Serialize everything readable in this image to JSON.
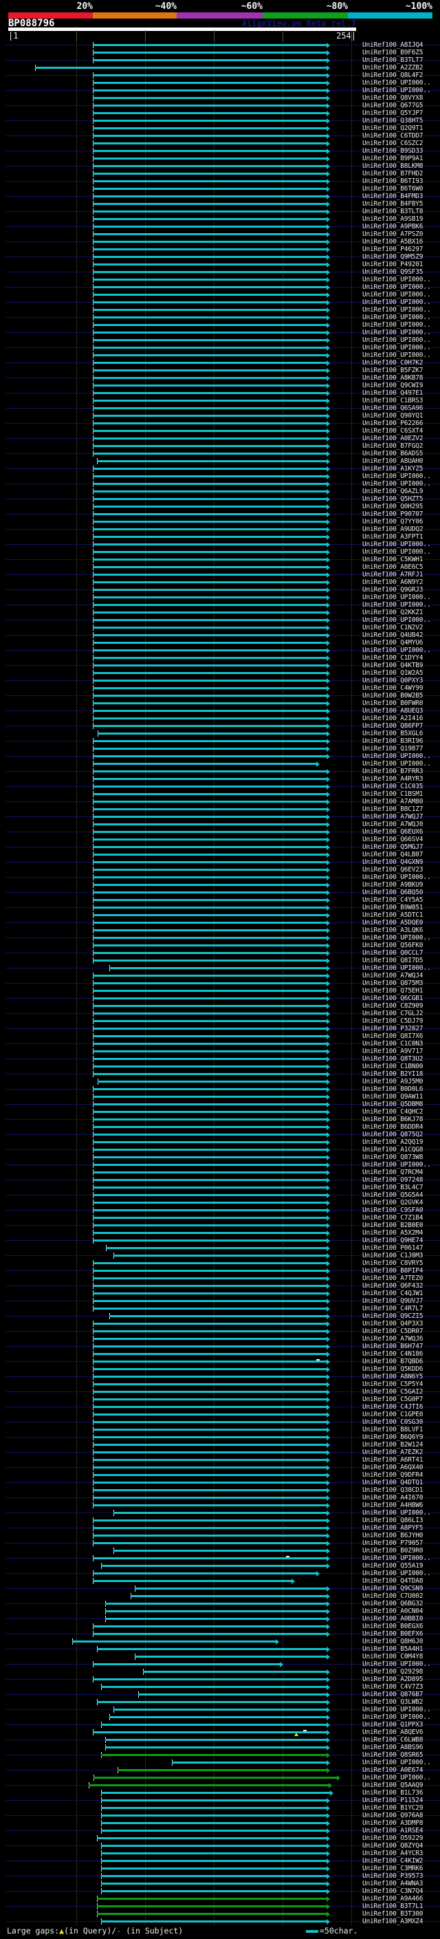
{
  "header": {
    "query_id": "BP088796",
    "watermark": "AlignView.pm Beta rel.7",
    "ruler_start": "|1",
    "ruler_end": "254|",
    "scale_labels": [
      "20%",
      "~40%",
      "~60%",
      "~80%",
      "~100%"
    ],
    "scale_colors": [
      "#e8192c",
      "#dd7711",
      "#a033b0",
      "#0fa01e",
      "#00b4cc"
    ],
    "scale_boundaries": [
      12,
      135,
      257,
      382,
      506,
      629
    ]
  },
  "colors": {
    "cyan": "#10c4cc",
    "green": "#0ca012"
  },
  "defaults": {
    "start": 135,
    "end": 480
  },
  "footer": {
    "large_gaps_label": "Large gaps:",
    "query_gap_symbol": "▲",
    "query_gap_text": "(in Query)/",
    "subject_gap_symbol": "-",
    "subject_gap_text": " (in Subject)",
    "bar_scale_text": "=50char."
  },
  "rows": [
    {
      "l": "UniRef100_A8IJQ4"
    },
    {
      "l": "UniRef100_B9F6Z5"
    },
    {
      "l": "UniRef100_B3TLT7"
    },
    {
      "l": "UniRef100_A2ZZB2",
      "s": 51
    },
    {
      "l": "UniRef100_Q8L4F2"
    },
    {
      "l": "UniRef100_UPI000.."
    },
    {
      "l": "UniRef100_UPI000.."
    },
    {
      "l": "UniRef100_Q8VYX8"
    },
    {
      "l": "UniRef100_Q677G5"
    },
    {
      "l": "UniRef100_Q5YJP7"
    },
    {
      "l": "UniRef100_Q38HT5"
    },
    {
      "l": "UniRef100_Q2Q9T1"
    },
    {
      "l": "UniRef100_C6TDD7"
    },
    {
      "l": "UniRef100_C6SZC2"
    },
    {
      "l": "UniRef100_B9SD33"
    },
    {
      "l": "UniRef100_B9P9A1"
    },
    {
      "l": "UniRef100_B8LKM8"
    },
    {
      "l": "UniRef100_B7FHD2"
    },
    {
      "l": "UniRef100_B6TI93"
    },
    {
      "l": "UniRef100_B6T6W0"
    },
    {
      "l": "UniRef100_B4FMD3"
    },
    {
      "l": "UniRef100_B4FBY5"
    },
    {
      "l": "UniRef100_B3TLT8"
    },
    {
      "l": "UniRef100_A9SB19"
    },
    {
      "l": "UniRef100_A9PBK6"
    },
    {
      "l": "UniRef100_A7PSZ0"
    },
    {
      "l": "UniRef100_A5BX16"
    },
    {
      "l": "UniRef100_P46297"
    },
    {
      "l": "UniRef100_Q9M5Z9"
    },
    {
      "l": "UniRef100_P49201"
    },
    {
      "l": "UniRef100_Q9SF35"
    },
    {
      "l": "UniRef100_UPI000.."
    },
    {
      "l": "UniRef100_UPI000.."
    },
    {
      "l": "UniRef100_UPI000.."
    },
    {
      "l": "UniRef100_UPI000.."
    },
    {
      "l": "UniRef100_UPI000.."
    },
    {
      "l": "UniRef100_UPI000.."
    },
    {
      "l": "UniRef100_UPI000.."
    },
    {
      "l": "UniRef100_UPI000.."
    },
    {
      "l": "UniRef100_UPI000.."
    },
    {
      "l": "UniRef100_UPI000.."
    },
    {
      "l": "UniRef100_UPI000.."
    },
    {
      "l": "UniRef100_C0H7K2"
    },
    {
      "l": "UniRef100_B5FZK7"
    },
    {
      "l": "UniRef100_A8KB78"
    },
    {
      "l": "UniRef100_Q9CWI9"
    },
    {
      "l": "UniRef100_Q497E1"
    },
    {
      "l": "UniRef100_C1BRS3"
    },
    {
      "l": "UniRef100_Q6SA96"
    },
    {
      "l": "UniRef100_Q90YQ1"
    },
    {
      "l": "UniRef100_P62266"
    },
    {
      "l": "UniRef100_C6SXT4"
    },
    {
      "l": "UniRef100_A0EZV2"
    },
    {
      "l": "UniRef100_B7FGQ2"
    },
    {
      "l": "UniRef100_B6ADS5"
    },
    {
      "l": "UniRef100_A8UAH0",
      "s": 141
    },
    {
      "l": "UniRef100_A1KYZ5"
    },
    {
      "l": "UniRef100_UPI000.."
    },
    {
      "l": "UniRef100_UPI000.."
    },
    {
      "l": "UniRef100_Q6AZL9"
    },
    {
      "l": "UniRef100_Q5HZT5"
    },
    {
      "l": "UniRef100_Q0H295"
    },
    {
      "l": "UniRef100_P90707"
    },
    {
      "l": "UniRef100_Q7YY06"
    },
    {
      "l": "UniRef100_A9UDQ2"
    },
    {
      "l": "UniRef100_A3FPT1"
    },
    {
      "l": "UniRef100_UPI000.."
    },
    {
      "l": "UniRef100_UPI000.."
    },
    {
      "l": "UniRef100_C5KWH1"
    },
    {
      "l": "UniRef100_A8E6C5"
    },
    {
      "l": "UniRef100_A7RFJ1"
    },
    {
      "l": "UniRef100_A6N9Y2"
    },
    {
      "l": "UniRef100_Q9GRJ3"
    },
    {
      "l": "UniRef100_UPI000.."
    },
    {
      "l": "UniRef100_UPI000.."
    },
    {
      "l": "UniRef100_Q2KKZ1"
    },
    {
      "l": "UniRef100_UPI000.."
    },
    {
      "l": "UniRef100_C1N2V2"
    },
    {
      "l": "UniRef100_Q4UB42"
    },
    {
      "l": "UniRef100_Q4MYU6"
    },
    {
      "l": "UniRef100_UPI000.."
    },
    {
      "l": "UniRef100_C1DYY4"
    },
    {
      "l": "UniRef100_Q4KTB9"
    },
    {
      "l": "UniRef100_Q1W2A5"
    },
    {
      "l": "UniRef100_Q0PXY3"
    },
    {
      "l": "UniRef100_C4WY99"
    },
    {
      "l": "UniRef100_B0W2B5"
    },
    {
      "l": "UniRef100_B0FWR0"
    },
    {
      "l": "UniRef100_A8UEQ3"
    },
    {
      "l": "UniRef100_A2I416"
    },
    {
      "l": "UniRef100_Q86FP7"
    },
    {
      "l": "UniRef100_B5XGL6",
      "s": 142
    },
    {
      "l": "UniRef100_B3RI96"
    },
    {
      "l": "UniRef100_Q19877"
    },
    {
      "l": "UniRef100_UPI000.."
    },
    {
      "l": "UniRef100_UPI000..",
      "e": 465
    },
    {
      "l": "UniRef100_B7FRR3"
    },
    {
      "l": "UniRef100_A4RYR3"
    },
    {
      "l": "UniRef100_C1C035"
    },
    {
      "l": "UniRef100_C1BSM1"
    },
    {
      "l": "UniRef100_A7AM80"
    },
    {
      "l": "UniRef100_B8C1Z7"
    },
    {
      "l": "UniRef100_A7WQJ7"
    },
    {
      "l": "UniRef100_A7WQJ0"
    },
    {
      "l": "UniRef100_Q6EUX6"
    },
    {
      "l": "UniRef100_Q66SV4"
    },
    {
      "l": "UniRef100_Q5MGJ7"
    },
    {
      "l": "UniRef100_Q4LB07"
    },
    {
      "l": "UniRef100_Q4GXN9"
    },
    {
      "l": "UniRef100_Q6EV23"
    },
    {
      "l": "UniRef100_UPI000.."
    },
    {
      "l": "UniRef100_A9BKU9"
    },
    {
      "l": "UniRef100_Q6BQ50"
    },
    {
      "l": "UniRef100_C4Y5A5"
    },
    {
      "l": "UniRef100_B9W851"
    },
    {
      "l": "UniRef100_A5DTC1"
    },
    {
      "l": "UniRef100_A5DQE0"
    },
    {
      "l": "UniRef100_A3LQK6"
    },
    {
      "l": "UniRef100_UPI000.."
    },
    {
      "l": "UniRef100_Q56FK0"
    },
    {
      "l": "UniRef100_Q0CCL7"
    },
    {
      "l": "UniRef100_Q8I7D5"
    },
    {
      "l": "UniRef100_UPI000..",
      "s": 159
    },
    {
      "l": "UniRef100_A7WQJ4"
    },
    {
      "l": "UniRef100_Q875M3"
    },
    {
      "l": "UniRef100_Q75EH1"
    },
    {
      "l": "UniRef100_Q6CGB1"
    },
    {
      "l": "UniRef100_C8Z909"
    },
    {
      "l": "UniRef100_C7GLJ2"
    },
    {
      "l": "UniRef100_C5DJ79"
    },
    {
      "l": "UniRef100_P32827"
    },
    {
      "l": "UniRef100_Q8I7X6"
    },
    {
      "l": "UniRef100_C1C0N3"
    },
    {
      "l": "UniRef100_A9V717"
    },
    {
      "l": "UniRef100_Q8T3U2"
    },
    {
      "l": "UniRef100_C1BN00"
    },
    {
      "l": "UniRef100_B2YI18"
    },
    {
      "l": "UniRef100_A9J5M0",
      "s": 142
    },
    {
      "l": "UniRef100_B0D0L6"
    },
    {
      "l": "UniRef100_Q9AW11"
    },
    {
      "l": "UniRef100_Q5DBM8"
    },
    {
      "l": "UniRef100_C4QHC2"
    },
    {
      "l": "UniRef100_B6KJ78"
    },
    {
      "l": "UniRef100_B6DDR4"
    },
    {
      "l": "UniRef100_Q875Q2"
    },
    {
      "l": "UniRef100_A2QQ19"
    },
    {
      "l": "UniRef100_A1CQG8"
    },
    {
      "l": "UniRef100_Q873W8"
    },
    {
      "l": "UniRef100_UPI000.."
    },
    {
      "l": "UniRef100_Q7RCM4"
    },
    {
      "l": "UniRef100_O97248"
    },
    {
      "l": "UniRef100_B3L4C7"
    },
    {
      "l": "UniRef100_Q5G5A4"
    },
    {
      "l": "UniRef100_Q2GVK4"
    },
    {
      "l": "UniRef100_C9SFA0"
    },
    {
      "l": "UniRef100_C7Z1B4"
    },
    {
      "l": "UniRef100_B2B0E0"
    },
    {
      "l": "UniRef100_A5X2M4"
    },
    {
      "l": "UniRef100_Q9HE74"
    },
    {
      "l": "UniRef100_P06147",
      "s": 154
    },
    {
      "l": "UniRef100_C1J0M3",
      "s": 165
    },
    {
      "l": "UniRef100_C8VRY5"
    },
    {
      "l": "UniRef100_B8PIP4"
    },
    {
      "l": "UniRef100_A7TEZ0"
    },
    {
      "l": "UniRef100_Q6F432"
    },
    {
      "l": "UniRef100_C4QJW1"
    },
    {
      "l": "UniRef100_Q9UVJ7"
    },
    {
      "l": "UniRef100_C4R7L7"
    },
    {
      "l": "UniRef100_Q9CZI5",
      "s": 159
    },
    {
      "l": "UniRef100_Q4P3X3"
    },
    {
      "l": "UniRef100_C5DR07"
    },
    {
      "l": "UniRef100_A7WQJ6"
    },
    {
      "l": "UniRef100_B6H747"
    },
    {
      "l": "UniRef100_C4N186"
    },
    {
      "l": "UniRef100_B7QBD6",
      "m": [
        [
          "dash",
          460
        ]
      ]
    },
    {
      "l": "UniRef100_Q5KDD6"
    },
    {
      "l": "UniRef100_A8N6Y5"
    },
    {
      "l": "UniRef100_C5P5Y4"
    },
    {
      "l": "UniRef100_C5GAI2"
    },
    {
      "l": "UniRef100_C5G0P7"
    },
    {
      "l": "UniRef100_C4JTI6"
    },
    {
      "l": "UniRef100_C1GPE0"
    },
    {
      "l": "UniRef100_C0SG30"
    },
    {
      "l": "UniRef100_B8LVF1"
    },
    {
      "l": "UniRef100_B6Q6Y9"
    },
    {
      "l": "UniRef100_B2W124"
    },
    {
      "l": "UniRef100_A7EZK2"
    },
    {
      "l": "UniRef100_A6RT41"
    },
    {
      "l": "UniRef100_A6QX40"
    },
    {
      "l": "UniRef100_Q9DFR4"
    },
    {
      "l": "UniRef100_Q4DTQ1"
    },
    {
      "l": "UniRef100_Q38CD1"
    },
    {
      "l": "UniRef100_A4I670"
    },
    {
      "l": "UniRef100_A4HBW6"
    },
    {
      "l": "UniRef100_UPI000..",
      "s": 165
    },
    {
      "l": "UniRef100_Q86LI3"
    },
    {
      "l": "UniRef100_A8PYF5"
    },
    {
      "l": "UniRef100_B6JYH0"
    },
    {
      "l": "UniRef100_P79057"
    },
    {
      "l": "UniRef100_B0Z9R0",
      "s": 165
    },
    {
      "l": "UniRef100_UPI000..",
      "m": [
        [
          "dash",
          416
        ]
      ]
    },
    {
      "l": "UniRef100_Q55A19",
      "s": 147
    },
    {
      "l": "UniRef100_UPI000..",
      "e": 465
    },
    {
      "l": "UniRef100_Q4TDA8",
      "e": 429
    },
    {
      "l": "UniRef100_Q9CSN9",
      "s": 196
    },
    {
      "l": "UniRef100_C7U002",
      "s": 190
    },
    {
      "l": "UniRef100_Q6BG32",
      "s": 153
    },
    {
      "l": "UniRef100_A0CN04",
      "s": 153
    },
    {
      "l": "UniRef100_A0BBI0",
      "s": 153
    },
    {
      "l": "UniRef100_B0EGX6"
    },
    {
      "l": "UniRef100_B0EFX6"
    },
    {
      "l": "UniRef100_Q8H6J0",
      "s": 105,
      "e": 406
    },
    {
      "l": "UniRef100_B5A4H1",
      "s": 141
    },
    {
      "l": "UniRef100_C0M4Y8",
      "s": 196
    },
    {
      "l": "UniRef100_UPI000..",
      "e": 412
    },
    {
      "l": "UniRef100_Q29298",
      "s": 208
    },
    {
      "l": "UniRef100_A2D895"
    },
    {
      "l": "UniRef100_C4V7Z3",
      "s": 147
    },
    {
      "l": "UniRef100_Q876B7",
      "s": 201
    },
    {
      "l": "UniRef100_Q3LWB2",
      "s": 141
    },
    {
      "l": "UniRef100_UPI000..",
      "s": 165
    },
    {
      "l": "UniRef100_UPI000..",
      "s": 159
    },
    {
      "l": "UniRef100_Q1PPX3",
      "s": 147
    },
    {
      "l": "UniRef100_A8QEV6",
      "m": [
        [
          "tri",
          428
        ],
        [
          "dash",
          441
        ]
      ]
    },
    {
      "l": "UniRef100_C6LWB8",
      "s": 153
    },
    {
      "l": "UniRef100_A8BS96",
      "s": 153
    },
    {
      "l": "UniRef100_Q8SR65",
      "s": 147,
      "c": "green"
    },
    {
      "l": "UniRef100_UPI000..",
      "s": 250
    },
    {
      "l": "UniRef100_A0E674",
      "s": 171,
      "c": "green"
    },
    {
      "l": "UniRef100_UPI000..",
      "s": 136,
      "e": 495,
      "c": "green"
    },
    {
      "l": "UniRef100_Q5AAQ9",
      "s": 129,
      "e": 483,
      "c": "green"
    },
    {
      "l": "UniRef100_B1L736",
      "s": 147,
      "e": 485
    },
    {
      "l": "UniRef100_P11524",
      "s": 147
    },
    {
      "l": "UniRef100_B1YC29",
      "s": 147
    },
    {
      "l": "UniRef100_Q976A8",
      "s": 147
    },
    {
      "l": "UniRef100_A3DMP8",
      "s": 147
    },
    {
      "l": "UniRef100_A1RSE4",
      "s": 147
    },
    {
      "l": "UniRef100_O59229",
      "s": 141
    },
    {
      "l": "UniRef100_Q8ZYQ4",
      "s": 147
    },
    {
      "l": "UniRef100_A4YCR3",
      "s": 147
    },
    {
      "l": "UniRef100_C4KIW2",
      "s": 147
    },
    {
      "l": "UniRef100_C3MRK6",
      "s": 147
    },
    {
      "l": "UniRef100_P39573",
      "s": 147
    },
    {
      "l": "UniRef100_A4WNA3",
      "s": 147
    },
    {
      "l": "UniRef100_C3N7Q4",
      "s": 147
    },
    {
      "l": "UniRef100_A9A466",
      "s": 141,
      "c": "green"
    },
    {
      "l": "UniRef100_B3T7L1",
      "s": 141,
      "c": "green"
    },
    {
      "l": "UniRef100_B3T300",
      "s": 141,
      "c": "green"
    },
    {
      "l": "UniRef100_A3MXZ4",
      "s": 147
    }
  ]
}
